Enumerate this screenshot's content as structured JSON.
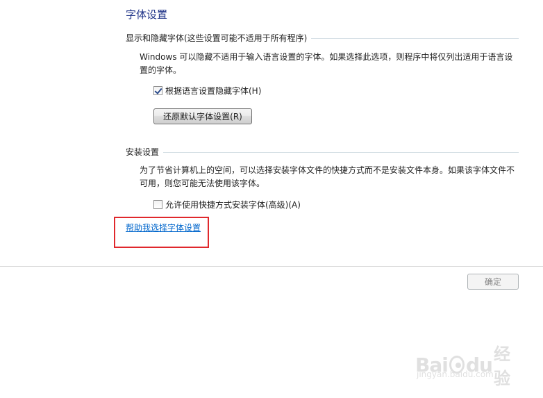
{
  "page": {
    "title": "字体设置"
  },
  "show_hide_section": {
    "header": "显示和隐藏字体(这些设置可能不适用于所有程序)",
    "description": "Windows 可以隐藏不适用于输入语言设置的字体。如果选择此选项，则程序中将仅列出适用于语言设置的字体。",
    "checkbox_label": "根据语言设置隐藏字体(H)",
    "checkbox_checked": true,
    "restore_button_label": "还原默认字体设置(R)"
  },
  "install_section": {
    "header": "安装设置",
    "description": "为了节省计算机上的空间，可以选择安装字体文件的快捷方式而不是安装文件本身。如果该字体文件不可用，则您可能无法使用该字体。",
    "checkbox_label": "允许使用快捷方式安装字体(高级)(A)",
    "checkbox_checked": false
  },
  "help_link": {
    "label": "帮助我选择字体设置"
  },
  "footer": {
    "ok_button_label": "确定",
    "ok_button_enabled": false
  },
  "watermark": {
    "site": "jingyan.baidu.com",
    "logo_text_left": "Bai",
    "logo_text_mid": "du",
    "logo_text_right": "经验"
  },
  "colors": {
    "title_blue": "#1e3287",
    "link_blue": "#0066cc",
    "highlight_red": "#e0282c",
    "divider_gray": "#d5dfe5"
  },
  "icons": {
    "watermark_logo": "baidu-paw-icon"
  }
}
